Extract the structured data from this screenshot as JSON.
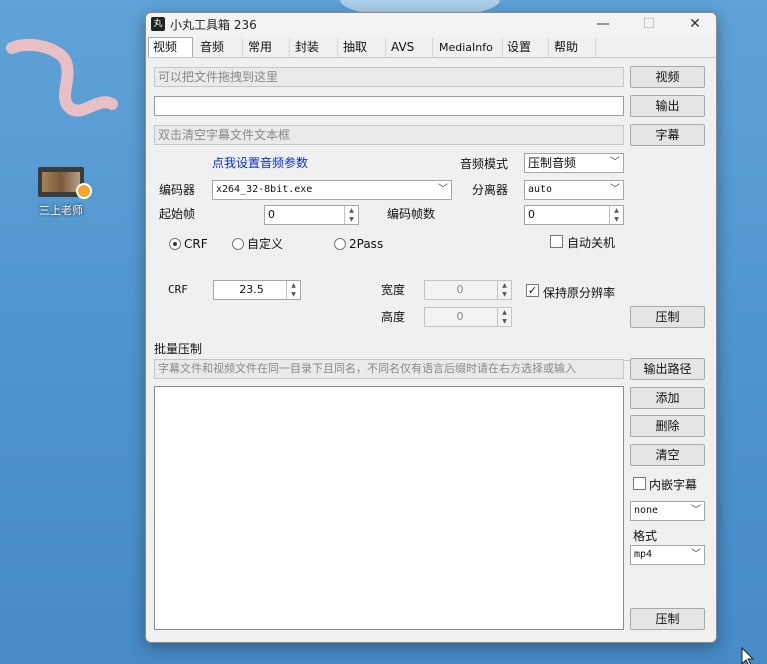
{
  "desktop": {
    "icon_label": "三上老师"
  },
  "window": {
    "title": "小丸工具箱 236",
    "icon_text": "丸",
    "controls": {
      "minimize": "—",
      "maximize": "☐",
      "close": "✕"
    }
  },
  "tabs": [
    "视频",
    "音频",
    "常用",
    "封装",
    "抽取",
    "AVS",
    "MediaInfo",
    "设置",
    "帮助"
  ],
  "video": {
    "drag_placeholder": "可以把文件拖拽到这里",
    "video_button": "视频",
    "output_value": "",
    "output_button": "输出",
    "subtitle_placeholder": "双击清空字幕文件文本框",
    "subtitle_button": "字幕",
    "audio_settings_link": "点我设置音频参数",
    "audio_mode_label": "音频模式",
    "audio_mode_value": "压制音频",
    "encoder_label": "编码器",
    "encoder_value": "x264_32-8bit.exe",
    "demuxer_label": "分离器",
    "demuxer_value": "auto",
    "start_frame_label": "起始帧",
    "start_frame_value": "0",
    "encode_frames_label": "编码帧数",
    "encode_frames_value": "0",
    "mode_crf": "CRF",
    "mode_custom": "自定义",
    "mode_2pass": "2Pass",
    "shutdown_label": "自动关机",
    "crf_label": "CRF",
    "crf_value": "23.5",
    "width_label": "宽度",
    "width_value": "0",
    "height_label": "高度",
    "height_value": "0",
    "keep_res_label": "保持原分辨率",
    "keep_res_mark": "✓",
    "encode_button": "压制"
  },
  "batch": {
    "group_label": "批量压制",
    "hint": "字幕文件和视频文件在同一目录下且同名，不同名仅有语言后缀时请在右方选择或输入",
    "output_path_button": "输出路径",
    "add_button": "添加",
    "delete_button": "删除",
    "clear_button": "清空",
    "embed_sub_label": "内嵌字幕",
    "sub_lang_value": "none",
    "format_label": "格式",
    "format_value": "mp4",
    "encode_button": "压制"
  }
}
